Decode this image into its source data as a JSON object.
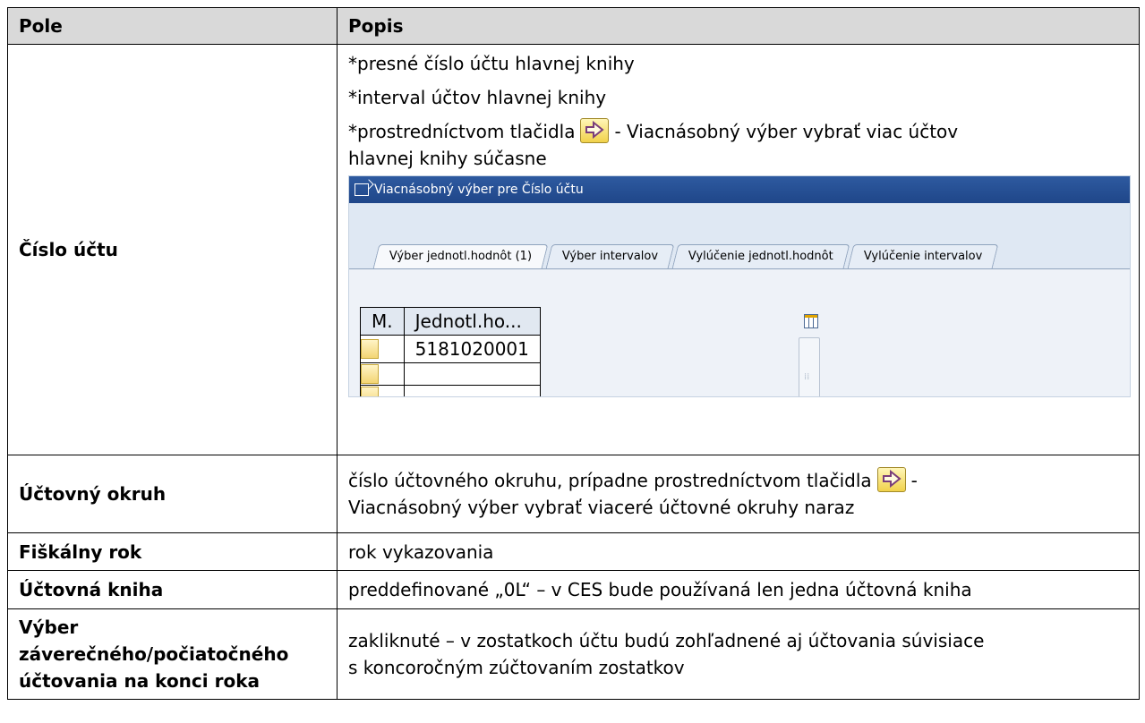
{
  "table": {
    "headers": {
      "field": "Pole",
      "description": "Popis"
    },
    "rows": [
      {
        "field": "Číslo účtu",
        "lines": [
          "*presné číslo účtu hlavnej knihy",
          "*interval účtov hlavnej knihy"
        ],
        "line3_before": "*prostredníctvom tlačidla",
        "line3_after": "- Viacnásobný výber vybrať viac účtov",
        "line4": "hlavnej knihy súčasne"
      },
      {
        "field": "Účtovný okruh",
        "line1_before": "číslo účtovného okruhu, prípadne prostredníctvom tlačidla",
        "line1_after": "-",
        "line2": "Viacnásobný výber vybrať viaceré účtovné okruhy naraz"
      },
      {
        "field": "Fiškálny rok",
        "description": "rok vykazovania"
      },
      {
        "field": "Účtovná kniha",
        "description": "preddefinované „0L“ – v CES bude používaná len jedna účtovná kniha"
      },
      {
        "field_lines": [
          "Výber",
          "záverečného/počiatočného",
          "účtovania na konci roka"
        ],
        "lines": [
          "zakliknuté – v zostatkoch účtu budú zohľadnené aj účtovania súvisiace",
          "s koncoročným zúčtovaním zostatkov"
        ]
      }
    ]
  },
  "sap_dialog": {
    "title": "Viacnásobný výber pre Číslo účtu",
    "tabs": [
      "Výber jednotl.hodnôt (1)",
      "Výber intervalov",
      "Vylúčenie jednotl.hodnôt",
      "Vylúčenie intervalov"
    ],
    "grid_headers": [
      "M.",
      "Jednotl.ho..."
    ],
    "grid_values": [
      "5181020001",
      "",
      ""
    ]
  },
  "icons": [
    "multiple-selection-arrow-icon",
    "column-settings-icon",
    "dialog-icon"
  ],
  "colors": {
    "header_bg": "#d9d9d9",
    "sap_title": "#1f4689",
    "button_yellow": "#f1d24b"
  }
}
